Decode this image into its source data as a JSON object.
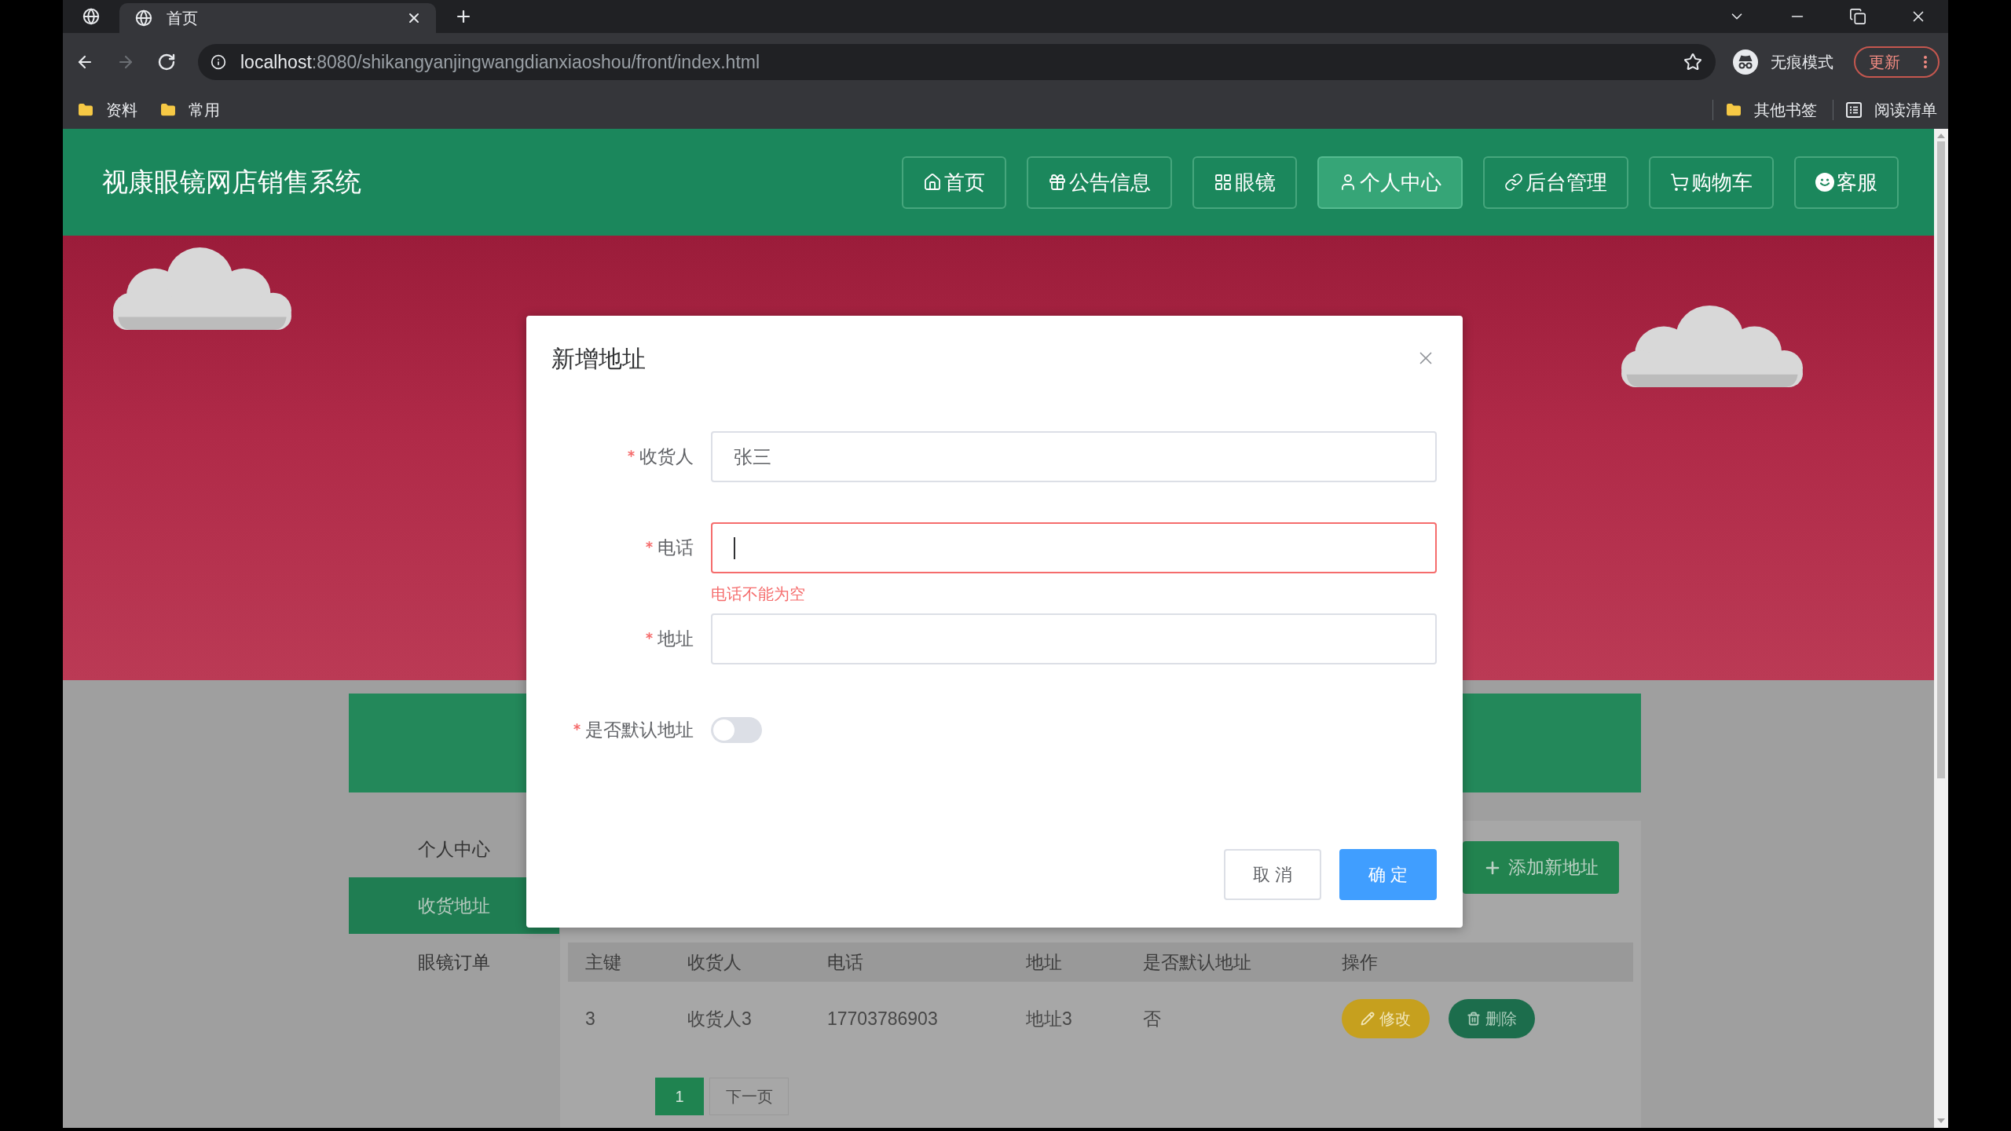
{
  "browser": {
    "tabs": [
      {
        "title": "首页",
        "selected": true
      }
    ],
    "forward_disabled": true,
    "address": {
      "host": "localhost",
      "path": ":8080/shikangyanjingwangdianxiaoshou/front/index.html"
    },
    "profile": "无痕模式",
    "update_button": "更新",
    "bookmarks": [
      {
        "label": "资料",
        "kind": "folder"
      },
      {
        "label": "常用",
        "kind": "folder"
      }
    ],
    "bookmarks_right": [
      {
        "label": "其他书签",
        "kind": "folder"
      },
      {
        "label": "阅读清单",
        "kind": "reading-list"
      }
    ]
  },
  "header": {
    "title": "视康眼镜网店销售系统",
    "nav": [
      {
        "label": "首页",
        "selected": false
      },
      {
        "label": "公告信息",
        "selected": false
      },
      {
        "label": "眼镜",
        "selected": false
      },
      {
        "label": "个人中心",
        "selected": true
      },
      {
        "label": "后台管理",
        "selected": false
      },
      {
        "label": "购物车",
        "selected": false
      },
      {
        "label": "客服",
        "selected": false
      }
    ]
  },
  "sidebar": {
    "items": [
      {
        "label": "个人中心",
        "selected": false
      },
      {
        "label": "收货地址",
        "selected": true
      },
      {
        "label": "眼镜订单",
        "selected": false
      }
    ]
  },
  "add_button": "添加新地址",
  "table": {
    "columns": [
      "主键",
      "收货人",
      "电话",
      "地址",
      "是否默认地址",
      "操作"
    ],
    "rows": [
      {
        "cells": [
          "3",
          "收货人3",
          "17703786903",
          "地址3",
          "否"
        ],
        "actions": [
          {
            "label": "修改",
            "kind": "edit"
          },
          {
            "label": "删除",
            "kind": "delete"
          }
        ]
      }
    ]
  },
  "pagination": {
    "pages": [
      {
        "label": "1",
        "selected": true
      }
    ],
    "next": "下一页"
  },
  "dialog": {
    "title": "新增地址",
    "fields": [
      {
        "label": "收货人",
        "required": true,
        "kind": "text",
        "value": "张三",
        "focused": false
      },
      {
        "label": "电话",
        "required": true,
        "kind": "text",
        "focused": true,
        "error": "电话不能为空"
      },
      {
        "label": "地址",
        "required": true,
        "kind": "text",
        "focused": false
      },
      {
        "label": "是否默认地址",
        "required": true,
        "kind": "switch",
        "on": false
      }
    ],
    "buttons": [
      {
        "label": "取 消",
        "kind": "default"
      },
      {
        "label": "确 定",
        "kind": "primary"
      }
    ]
  }
}
